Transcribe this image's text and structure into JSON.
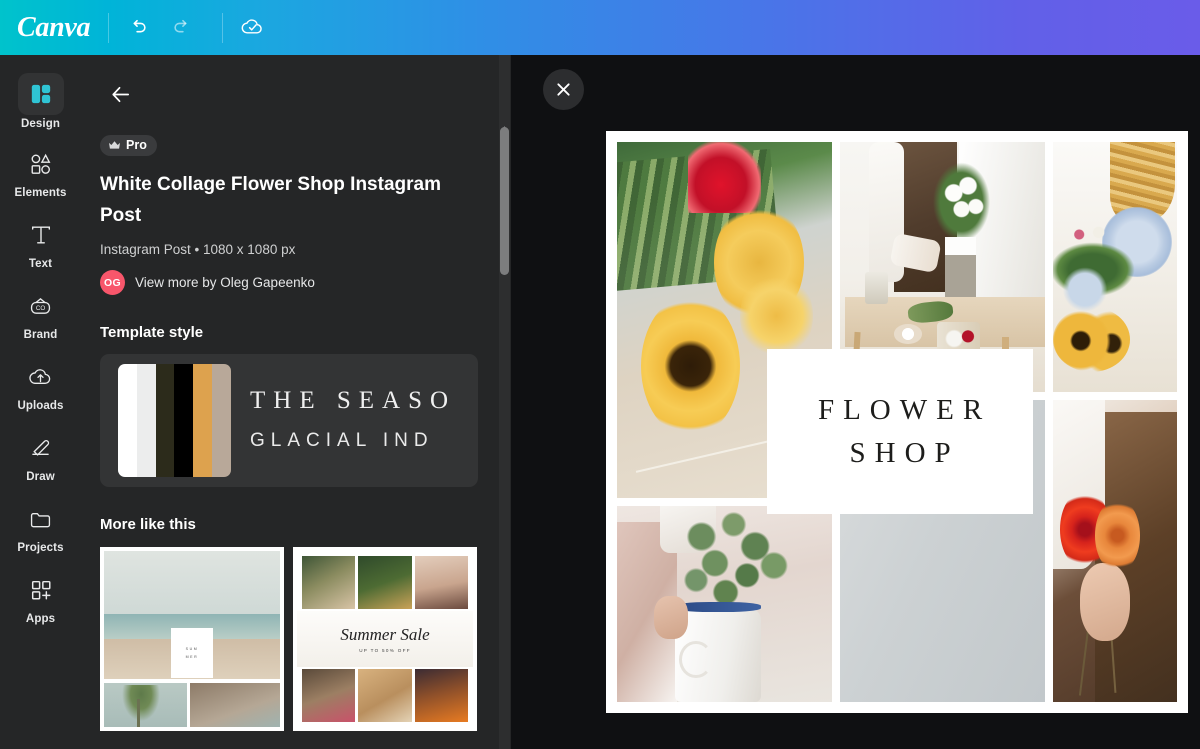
{
  "topbar": {
    "logo": "Canva",
    "undo_label": "Undo",
    "redo_label": "Redo",
    "saved_label": "Saved to cloud",
    "gradient_start": "#00C3CC",
    "gradient_end": "#6A5CE9"
  },
  "rail": {
    "items": [
      {
        "label": "Design",
        "icon": "design-icon",
        "selected": true
      },
      {
        "label": "Elements",
        "icon": "elements-icon",
        "selected": false
      },
      {
        "label": "Text",
        "icon": "text-icon",
        "selected": false
      },
      {
        "label": "Brand",
        "icon": "brand-icon",
        "selected": false
      },
      {
        "label": "Uploads",
        "icon": "uploads-icon",
        "selected": false
      },
      {
        "label": "Draw",
        "icon": "draw-icon",
        "selected": false
      },
      {
        "label": "Projects",
        "icon": "projects-icon",
        "selected": false
      },
      {
        "label": "Apps",
        "icon": "apps-icon",
        "selected": false
      }
    ]
  },
  "panel": {
    "back_label": "Back",
    "pro_badge": "Pro",
    "template_title": "White Collage Flower Shop Instagram Post",
    "template_meta": "Instagram Post • 1080 x 1080 px",
    "author_initials": "OG",
    "author_link": "View more by Oleg Gapeenko",
    "author_color": "#F8566B",
    "template_style_heading": "Template style",
    "style_card": {
      "line1": "THE SEASO",
      "line2": "GLACIAL IND",
      "colors": [
        "#ffffff",
        "#eceded",
        "#2c2b1b",
        "#000000",
        "#dda24e",
        "#b8a899"
      ]
    },
    "more_like_this_heading": "More like this",
    "thumbnails": [
      {
        "name": "beach-collage-template",
        "card_line1": "SUM",
        "card_line2": "MER"
      },
      {
        "name": "summer-sale-collage-template",
        "title": "Summer Sale",
        "subtitle": "UP TO 50% OFF"
      }
    ]
  },
  "editor": {
    "close_label": "Close",
    "canvas": {
      "title_line1": "FLOWER",
      "title_line2": "SHOP",
      "background": "#ffffff",
      "cells": [
        {
          "name": "sunflowers-bouquet-photo"
        },
        {
          "name": "florist-arranging-roses-photo"
        },
        {
          "name": "dried-flowers-hydrangea-photo"
        },
        {
          "name": "eucalyptus-in-pitcher-photo"
        },
        {
          "name": "plain-gray-wall-photo"
        },
        {
          "name": "hand-holding-roses-photo"
        }
      ]
    }
  }
}
